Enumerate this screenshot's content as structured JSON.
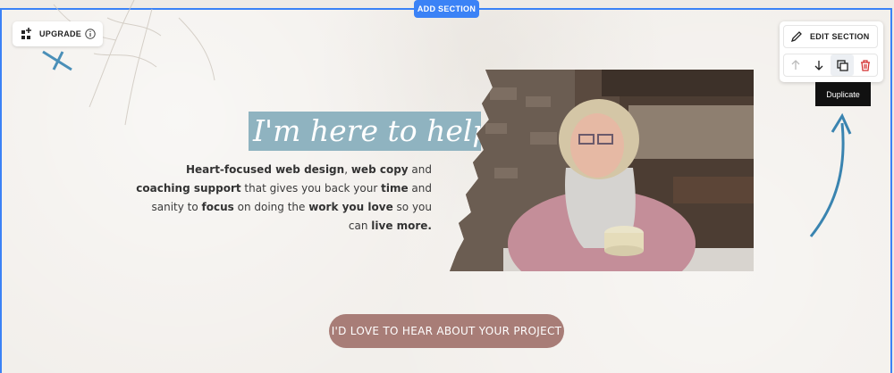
{
  "editor": {
    "add_section_label": "ADD SECTION",
    "upgrade_label": "UPGRADE",
    "edit_section_label": "EDIT SECTION",
    "tooltip": "Duplicate",
    "accent_color": "#3b82f6",
    "icons": [
      "grid-plus-icon",
      "info-icon",
      "pencil-icon",
      "arrow-up-icon",
      "arrow-down-icon",
      "duplicate-icon",
      "trash-icon"
    ]
  },
  "hero": {
    "heading": "I'm here to help...",
    "body": {
      "p1": "Heart-focused web design",
      "p2": ", ",
      "p3": "web copy",
      "p4": " and ",
      "p5": "coaching support",
      "p6": " that gives you back your ",
      "p7": "time",
      "p8": " and sanity to ",
      "p9": "focus",
      "p10": " on doing the ",
      "p11": "work you love",
      "p12": " so you can ",
      "p13": "live more."
    },
    "cta_label": "I'D LOVE TO HEAR ABOUT YOUR PROJECT",
    "heading_band_color": "#8fb3c0",
    "cta_color": "#a87d77"
  }
}
